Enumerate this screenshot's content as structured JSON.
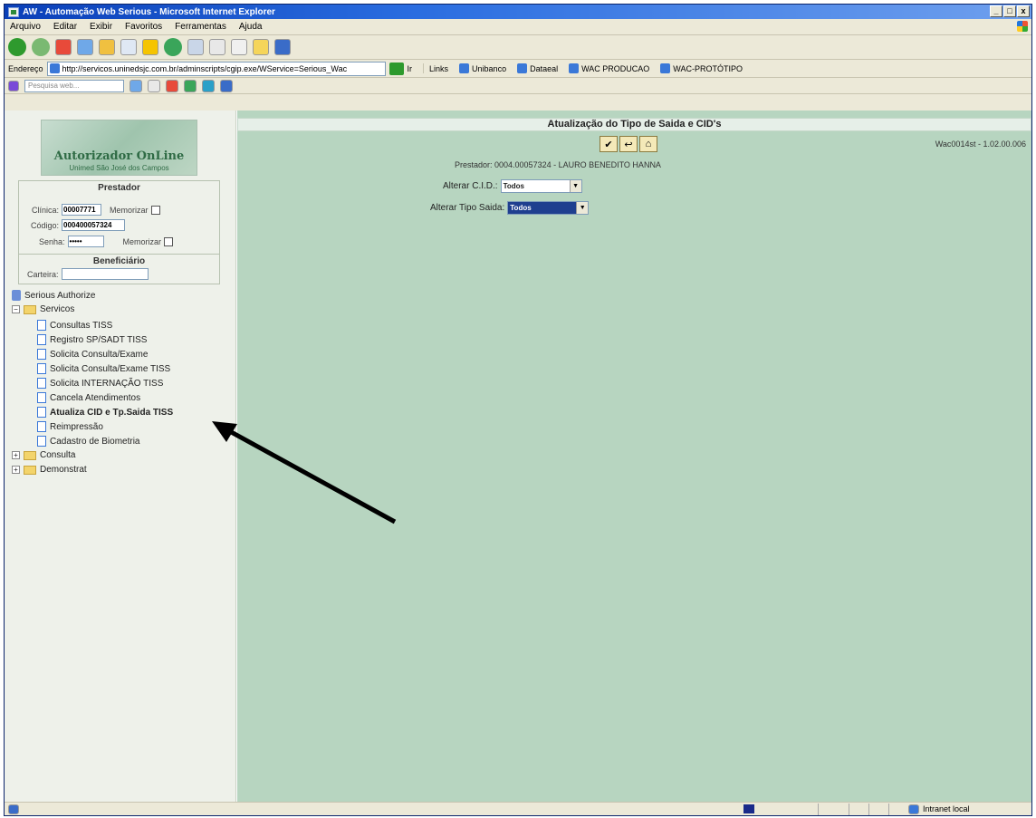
{
  "window": {
    "title": "AW - Automação Web Serious - Microsoft Internet Explorer",
    "controls": [
      "_",
      "□",
      "x"
    ]
  },
  "menu": [
    "Arquivo",
    "Editar",
    "Exibir",
    "Favoritos",
    "Ferramentas",
    "Ajuda"
  ],
  "address": {
    "label": "Endereço",
    "url": "http://servicos.uninedsjc.com.br/adminscripts/cgip.exe/WService=Serious_Wac",
    "go_label": "Ir"
  },
  "links": {
    "label": "Links",
    "items": [
      "Unibanco",
      "Dataeal",
      "WAC PRODUCAO",
      "WAC-PROTÓTIPO"
    ]
  },
  "search": {
    "placeholder": "Pesquisa web..."
  },
  "sidebar": {
    "logo_title": "Autorizador OnLine",
    "logo_subtitle": "Unimed São José dos Campos",
    "prestador": {
      "header": "Prestador",
      "clinica_label": "Clínica:",
      "clinica_value": "00007771",
      "memorizar1": "Memorizar",
      "codigo_label": "Código:",
      "codigo_value": "000400057324",
      "senha_label": "Senha:",
      "senha_value": "•••••",
      "memorizar2": "Memorizar"
    },
    "beneficiario": {
      "header": "Beneficiário",
      "carteira_label": "Carteira:",
      "carteira_value": ""
    },
    "tree": {
      "root": "Serious Authorize",
      "servicos": "Servicos",
      "items": [
        "Consultas TISS",
        "Registro SP/SADT TISS",
        "Solicita Consulta/Exame",
        "Solicita Consulta/Exame TISS",
        "Solicita INTERNAÇÃO TISS",
        "Cancela Atendimentos",
        "Atualiza CID e Tp.Saida TISS",
        "Reimpressão",
        "Cadastro de Biometria"
      ],
      "consulta": "Consulta",
      "demonstrat": "Demonstrat"
    }
  },
  "main": {
    "title": "Atualização do Tipo de Saida e CID's",
    "version": "Wac0014st - 1.02.00.006",
    "prestador_line": "Prestador: 0004.00057324 - LAURO BENEDITO HANNA",
    "alterar_cid_label": "Alterar C.I.D.:",
    "alterar_cid_value": "Todos",
    "alterar_tipo_label": "Alterar Tipo Saida:",
    "alterar_tipo_value": "Todos"
  },
  "status": {
    "zone": "Intranet local"
  },
  "colors": {
    "main_bg": "#b7d5c0",
    "sidebar_bg": "#eef1ea",
    "title_bar": "#0a3fb8"
  }
}
